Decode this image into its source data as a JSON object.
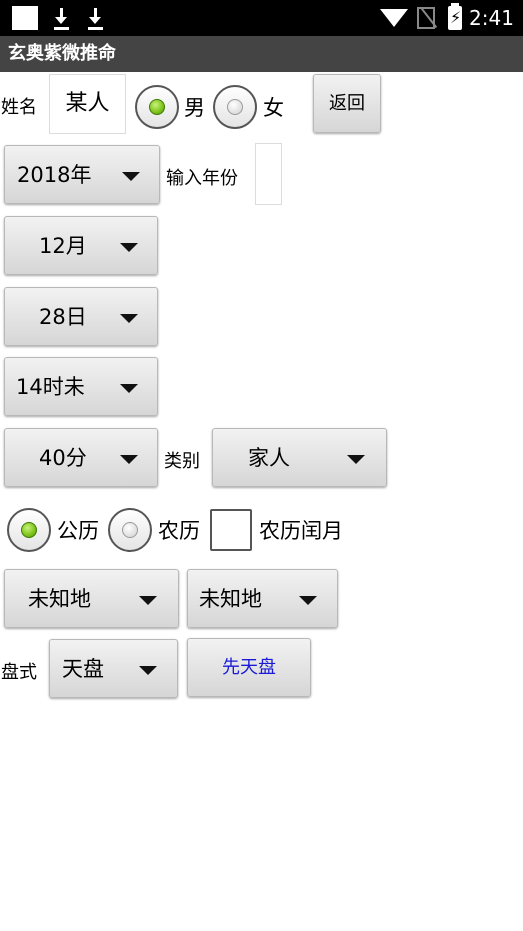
{
  "status_bar": {
    "time": "2:41",
    "icons": [
      "notification-square-icon",
      "download-icon",
      "download-icon",
      "wifi-icon",
      "no-sim-icon",
      "battery-charging-icon"
    ]
  },
  "app": {
    "title": "玄奥紫微推命"
  },
  "name_row": {
    "label": "姓名",
    "name_value": "某人",
    "male_label": "男",
    "female_label": "女",
    "gender_selected": "男",
    "back_button": "返回"
  },
  "year_row": {
    "year": "2018年",
    "input_year_label": "输入年份",
    "input_year_value": ""
  },
  "month": "12月",
  "day": "28日",
  "hour": "14时未",
  "minute_row": {
    "minute": "40分",
    "category_label": "类别",
    "category": "家人"
  },
  "calendar_row": {
    "solar_label": "公历",
    "lunar_label": "农历",
    "leap_label": "农历闰月",
    "selected": "公历",
    "leap_checked": false
  },
  "place_row": {
    "place1": "未知地",
    "place2": "未知地"
  },
  "chart_row": {
    "label": "盘式",
    "chart_type": "天盘",
    "button": "先天盘",
    "button_color": "#1a1ad8"
  },
  "colors": {
    "title_bar": "#444444",
    "radio_selected": "#7cc21a"
  }
}
